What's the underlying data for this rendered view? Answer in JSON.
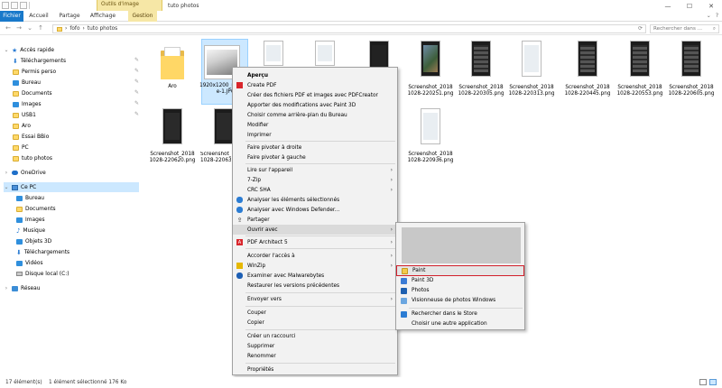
{
  "window": {
    "title": "tuto photos",
    "context_tab_header": "Outils d'image",
    "buttons": [
      "—",
      "☐",
      "✕"
    ]
  },
  "ribbon": {
    "tabs": [
      {
        "label": "Fichier"
      },
      {
        "label": "Accueil"
      },
      {
        "label": "Partage"
      },
      {
        "label": "Affichage"
      },
      {
        "label": "Gestion"
      }
    ]
  },
  "address": {
    "back": "←",
    "forward": "→",
    "up_recent": "⌄",
    "up": "↑",
    "path": [
      "fofo",
      "tuto photos"
    ],
    "search_placeholder": "Rechercher dans ..."
  },
  "nav": {
    "quick_access": "Accès rapide",
    "items": [
      {
        "label": "Téléchargements",
        "pinned": true
      },
      {
        "label": "Permis perso",
        "pinned": true
      },
      {
        "label": "Bureau",
        "pinned": true
      },
      {
        "label": "Documents",
        "pinned": true
      },
      {
        "label": "Images",
        "pinned": true
      },
      {
        "label": "USB1",
        "pinned": true
      },
      {
        "label": "Aro",
        "pinned": false
      },
      {
        "label": "Essai BBio",
        "pinned": false
      },
      {
        "label": "PC",
        "pinned": false
      },
      {
        "label": "tuto photos",
        "pinned": false
      }
    ],
    "onedrive": "OneDrive",
    "this_pc": "Ce PC",
    "pc_items": [
      "Bureau",
      "Documents",
      "Images",
      "Musique",
      "Objets 3D",
      "Téléchargements",
      "Vidéos",
      "Disque local (C:)"
    ],
    "network": "Réseau"
  },
  "files": [
    {
      "label": "Aro"
    },
    {
      "label": "1920x1200_n_lagaffe-1.JPG"
    },
    {
      "label": ""
    },
    {
      "label": ""
    },
    {
      "label": "Screenshot_2018\n1028-220251.png"
    },
    {
      "label": "Screenshot_2018\n1028-220305.png"
    },
    {
      "label": "Screenshot_2018\n1028-220313.png"
    },
    {
      "label": "Screenshot_2018\n1028-220445.png"
    },
    {
      "label": "Screenshot_2018\n1028-220553.png"
    },
    {
      "label": "Screenshot_2018\n1028-220605.png"
    },
    {
      "label": "Screenshot_2018\n1028-220620.png"
    },
    {
      "label": "Screenshot_2018\n1028-22063"
    },
    {
      "label": "Screenshot_2018\n1028-220936.png"
    }
  ],
  "context_menu": {
    "items": [
      {
        "label": "Aperçu",
        "bold": true
      },
      {
        "label": "Create PDF"
      },
      {
        "label": "Créer des fichiers PDF et images avec PDFCreator"
      },
      {
        "label": "Apporter des modifications avec Paint 3D"
      },
      {
        "label": "Choisir comme arrière-plan du Bureau"
      },
      {
        "label": "Modifier"
      },
      {
        "label": "Imprimer"
      },
      {
        "label": "Faire pivoter à droite"
      },
      {
        "label": "Faire pivoter à gauche"
      },
      {
        "label": "Lire sur l'appareil",
        "arrow": true
      },
      {
        "label": "7-Zip",
        "arrow": true
      },
      {
        "label": "CRC SHA",
        "arrow": true
      },
      {
        "label": "Analyser les éléments sélectionnés"
      },
      {
        "label": "Analyser avec Windows Defender..."
      },
      {
        "label": "Partager"
      },
      {
        "label": "Ouvrir avec",
        "arrow": true,
        "hover": true
      },
      {
        "label": "PDF Architect 5",
        "arrow": true
      },
      {
        "label": "Accorder l'accès à",
        "arrow": true
      },
      {
        "label": "WinZip",
        "arrow": true
      },
      {
        "label": "Examiner avec Malwarebytes"
      },
      {
        "label": "Restaurer les versions précédentes"
      },
      {
        "label": "Envoyer vers",
        "arrow": true
      },
      {
        "label": "Couper"
      },
      {
        "label": "Copier"
      },
      {
        "label": "Créer un raccourci"
      },
      {
        "label": "Supprimer"
      },
      {
        "label": "Renommer"
      },
      {
        "label": "Propriétés"
      }
    ]
  },
  "submenu": {
    "items": [
      {
        "label": "Paint",
        "highlight": true
      },
      {
        "label": "Paint 3D"
      },
      {
        "label": "Photos"
      },
      {
        "label": "Visionneuse de photos Windows"
      },
      {
        "label": "Rechercher dans le Store"
      },
      {
        "label": "Choisir une autre application"
      }
    ]
  },
  "status": {
    "count": "17 élément(s)",
    "selection": "1 élément sélectionné  176 Ko"
  },
  "colors": {
    "accent": "#1979ca",
    "selection": "#cce8ff",
    "highlight_border": "#d11f2a",
    "context_tab": "#f6e7a6"
  }
}
